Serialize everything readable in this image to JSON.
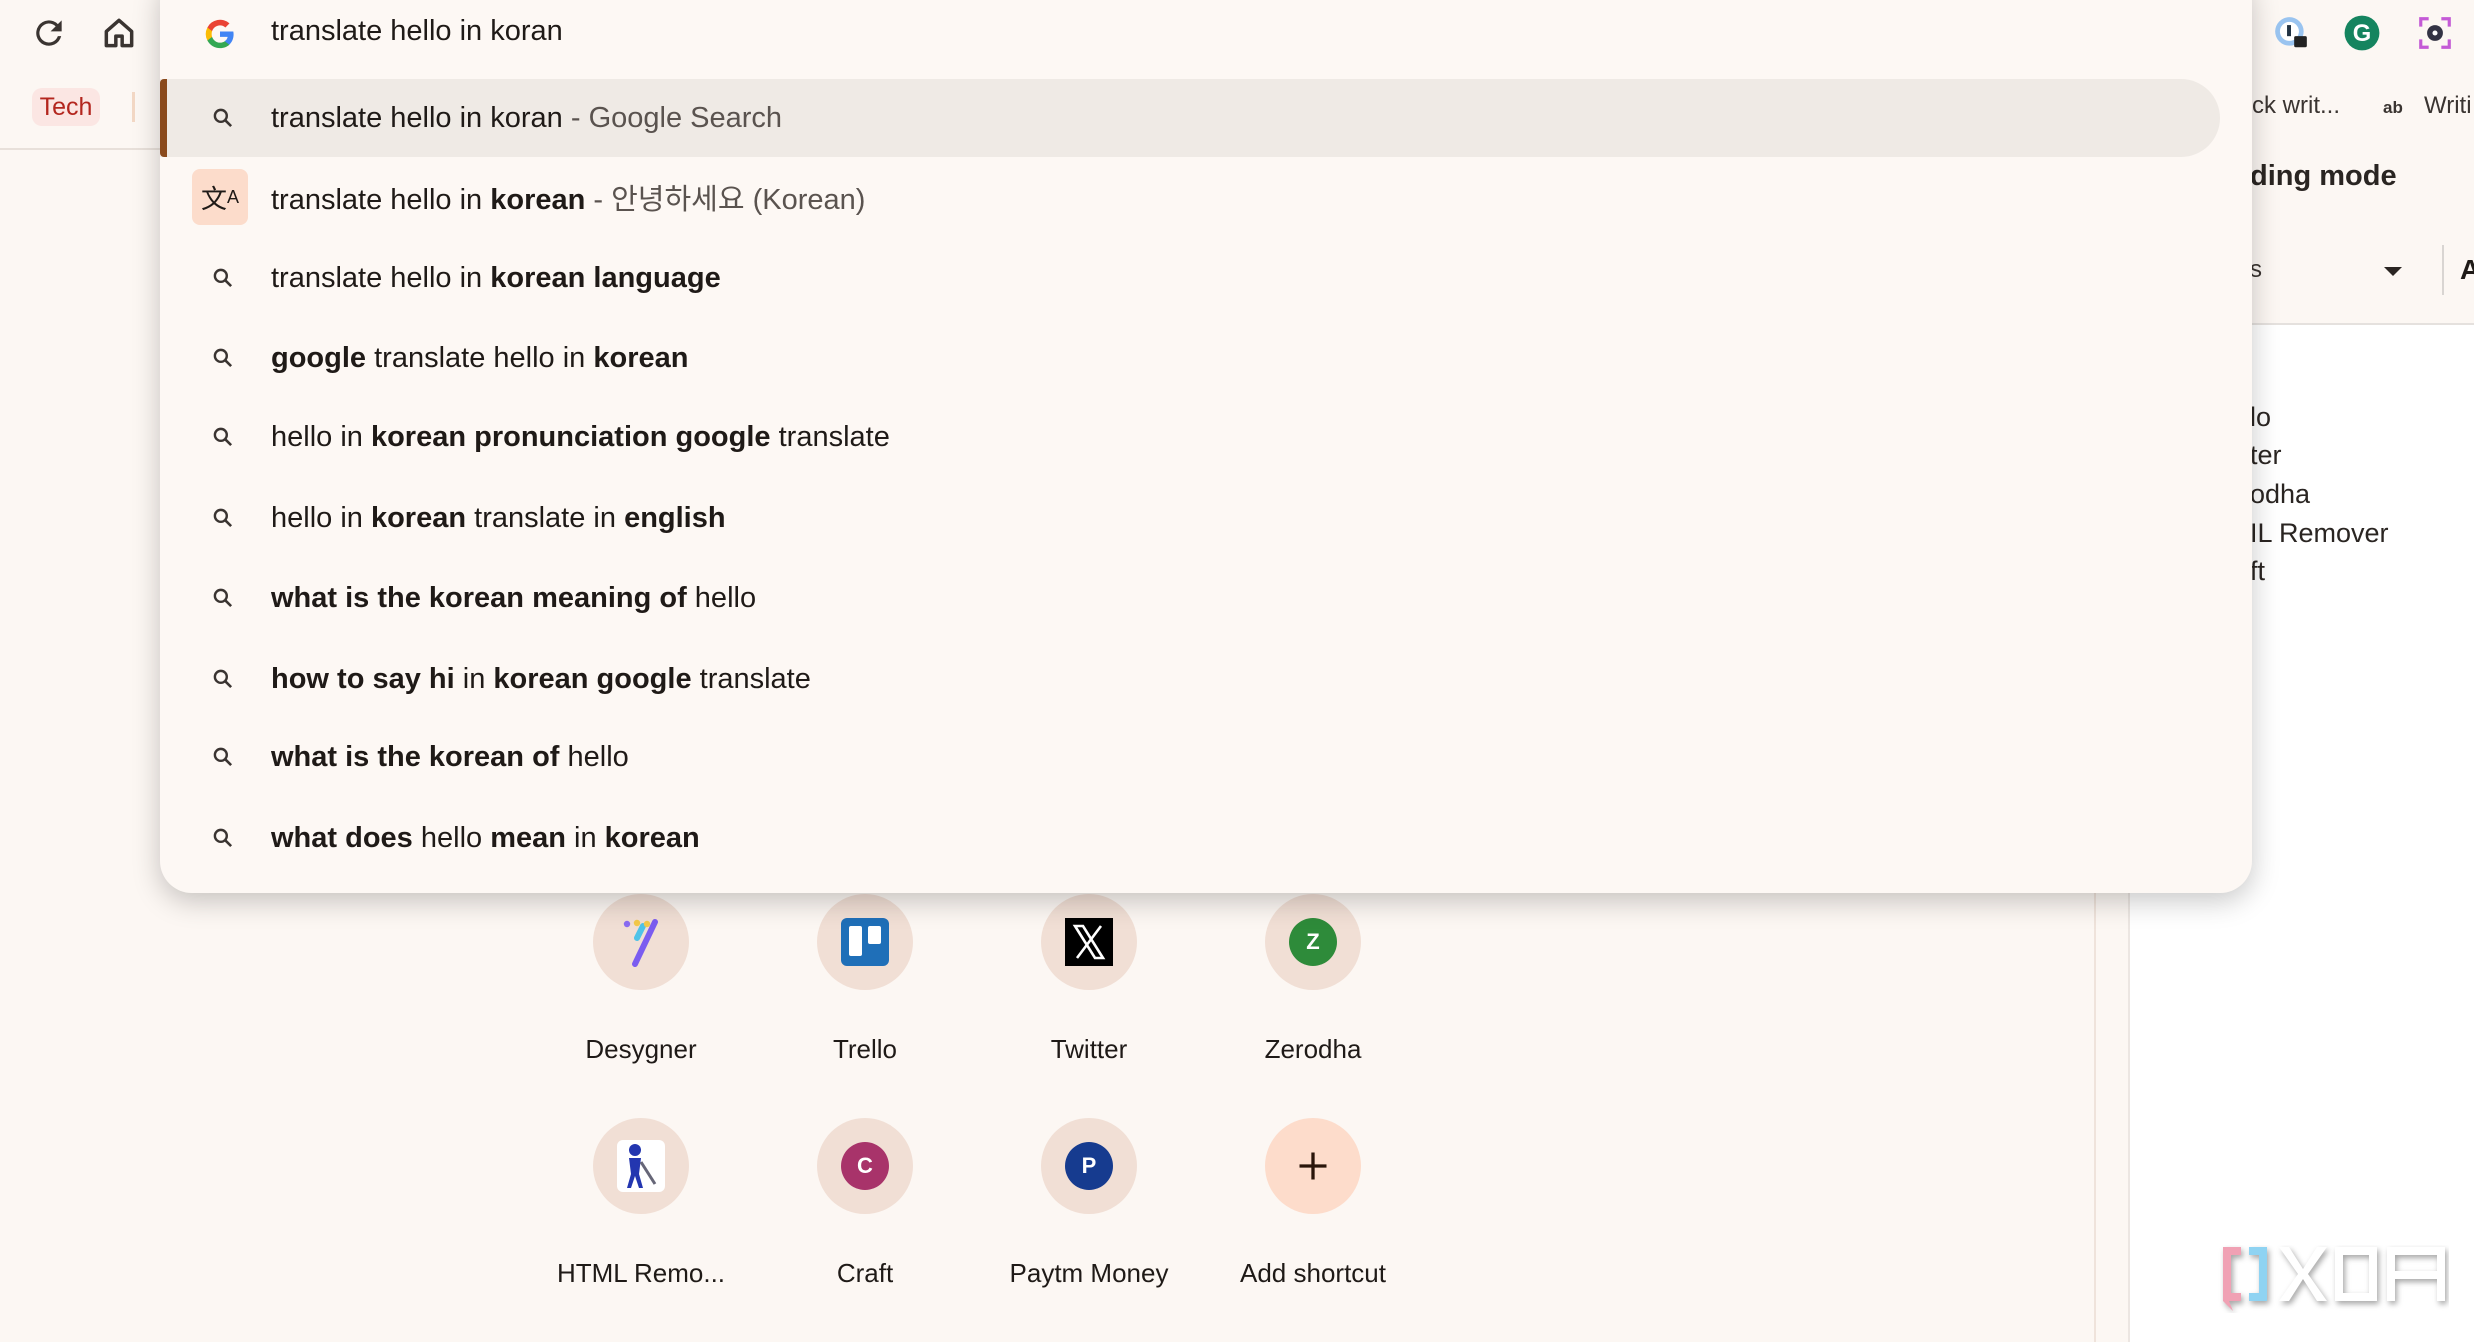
{
  "toolbar": {
    "reload_icon": "reload-icon",
    "home_icon": "home-icon",
    "bookmark_chip": "Tech",
    "extensions": [
      "password-manager-icon",
      "grammarly-icon",
      "screen-capture-icon"
    ]
  },
  "bookmarks_bar": {
    "items": [
      "ck writ...",
      "ab",
      "Writi"
    ]
  },
  "reading_mode": {
    "title": "ding mode",
    "select_value": "s",
    "font_button": "A",
    "items": [
      "lo",
      "ter",
      "odha",
      "IL Remover",
      "ft"
    ]
  },
  "omnibox": {
    "input_value": "translate hello in koran",
    "suggestions": [
      {
        "icon": "search",
        "parts": [
          {
            "text": "translate hello in koran",
            "bold": false
          },
          {
            "text": " - Google Search",
            "bold": false,
            "dim": true
          }
        ],
        "highlighted": true
      },
      {
        "icon": "translate",
        "parts": [
          {
            "text": "translate hello in ",
            "bold": false
          },
          {
            "text": "korean",
            "bold": true
          },
          {
            "text": " - 안녕하세요 (Korean)",
            "bold": false,
            "dim": true
          }
        ]
      },
      {
        "icon": "search",
        "parts": [
          {
            "text": "translate hello in ",
            "bold": false
          },
          {
            "text": "korean language",
            "bold": true
          }
        ]
      },
      {
        "icon": "search",
        "parts": [
          {
            "text": "google",
            "bold": true
          },
          {
            "text": " translate hello in ",
            "bold": false
          },
          {
            "text": "korean",
            "bold": true
          }
        ]
      },
      {
        "icon": "search",
        "parts": [
          {
            "text": "hello in ",
            "bold": false
          },
          {
            "text": "korean pronunciation google",
            "bold": true
          },
          {
            "text": " translate",
            "bold": false
          }
        ]
      },
      {
        "icon": "search",
        "parts": [
          {
            "text": "hello in ",
            "bold": false
          },
          {
            "text": "korean",
            "bold": true
          },
          {
            "text": " translate in ",
            "bold": false
          },
          {
            "text": "english",
            "bold": true
          }
        ]
      },
      {
        "icon": "search",
        "parts": [
          {
            "text": "what is the korean meaning of",
            "bold": true
          },
          {
            "text": " hello",
            "bold": false
          }
        ]
      },
      {
        "icon": "search",
        "parts": [
          {
            "text": "how to say hi",
            "bold": true
          },
          {
            "text": " in ",
            "bold": false
          },
          {
            "text": "korean google",
            "bold": true
          },
          {
            "text": " translate",
            "bold": false
          }
        ]
      },
      {
        "icon": "search",
        "parts": [
          {
            "text": "what is the korean of",
            "bold": true
          },
          {
            "text": " hello",
            "bold": false
          }
        ]
      },
      {
        "icon": "search",
        "parts": [
          {
            "text": "what does",
            "bold": true
          },
          {
            "text": " hello ",
            "bold": false
          },
          {
            "text": "mean",
            "bold": true
          },
          {
            "text": " in ",
            "bold": false
          },
          {
            "text": "korean",
            "bold": true
          }
        ]
      }
    ]
  },
  "shortcuts": [
    {
      "label": "Desygner",
      "icon": "desygner-icon"
    },
    {
      "label": "Trello",
      "icon": "trello-icon"
    },
    {
      "label": "Twitter",
      "icon": "x-icon"
    },
    {
      "label": "Zerodha",
      "icon": "letter-z-icon",
      "letter": "Z",
      "color": "#2e8b3a"
    },
    {
      "label": "HTML Remo...",
      "icon": "html-remover-icon"
    },
    {
      "label": "Craft",
      "icon": "letter-c-icon",
      "letter": "C",
      "color": "#a8336a"
    },
    {
      "label": "Paytm Money",
      "icon": "letter-p-icon",
      "letter": "P",
      "color": "#163b8f"
    },
    {
      "label": "Add shortcut",
      "icon": "plus-icon"
    }
  ],
  "watermark": "XDA",
  "colors": {
    "accent": "#8a4a1c",
    "background": "#fcf7f3",
    "highlight": "#efeae5",
    "chip": "#b3261e"
  }
}
